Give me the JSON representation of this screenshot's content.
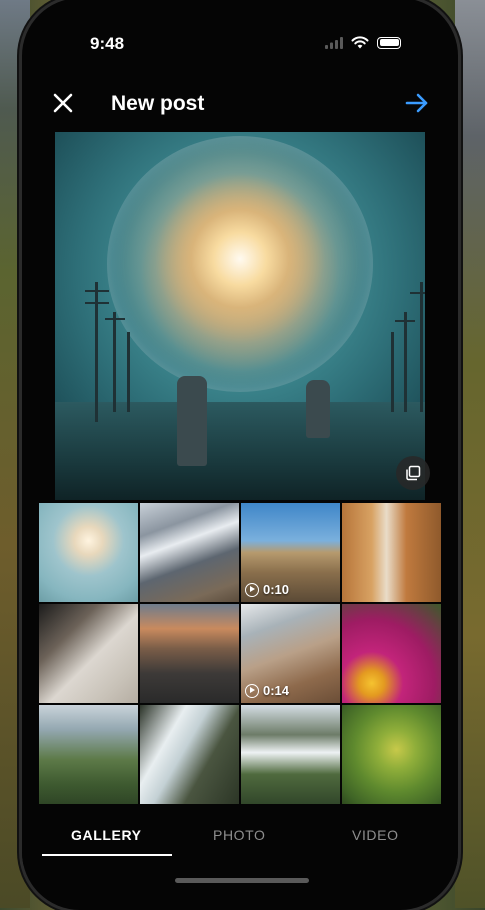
{
  "status_bar": {
    "time": "9:48"
  },
  "header": {
    "title": "New post"
  },
  "colors": {
    "accent": "#3b9cff",
    "background": "#050505",
    "inactive_tab": "#8e8e8e"
  },
  "icons": {
    "close": "close-icon",
    "next": "arrow-right-icon",
    "multi_select": "multiple-select-icon",
    "signal": "signal-icon",
    "wifi": "wifi-icon",
    "battery": "battery-icon"
  },
  "gallery": {
    "tiles": [
      {
        "kind": "photo",
        "name": "glowing-orb"
      },
      {
        "kind": "photo",
        "name": "snowy-mountains"
      },
      {
        "kind": "video",
        "name": "desert-road",
        "duration": "0:10"
      },
      {
        "kind": "photo",
        "name": "rock-arch"
      },
      {
        "kind": "photo",
        "name": "candles"
      },
      {
        "kind": "photo",
        "name": "rocky-coast"
      },
      {
        "kind": "video",
        "name": "beach-walker",
        "duration": "0:14"
      },
      {
        "kind": "photo",
        "name": "pink-flowers"
      },
      {
        "kind": "photo",
        "name": "waterfall-valley"
      },
      {
        "kind": "photo",
        "name": "waterfall-stream"
      },
      {
        "kind": "photo",
        "name": "waterfall-cliff"
      },
      {
        "kind": "photo",
        "name": "lemon-tree"
      }
    ]
  },
  "tabs": {
    "gallery": "GALLERY",
    "photo": "PHOTO",
    "video": "VIDEO"
  }
}
